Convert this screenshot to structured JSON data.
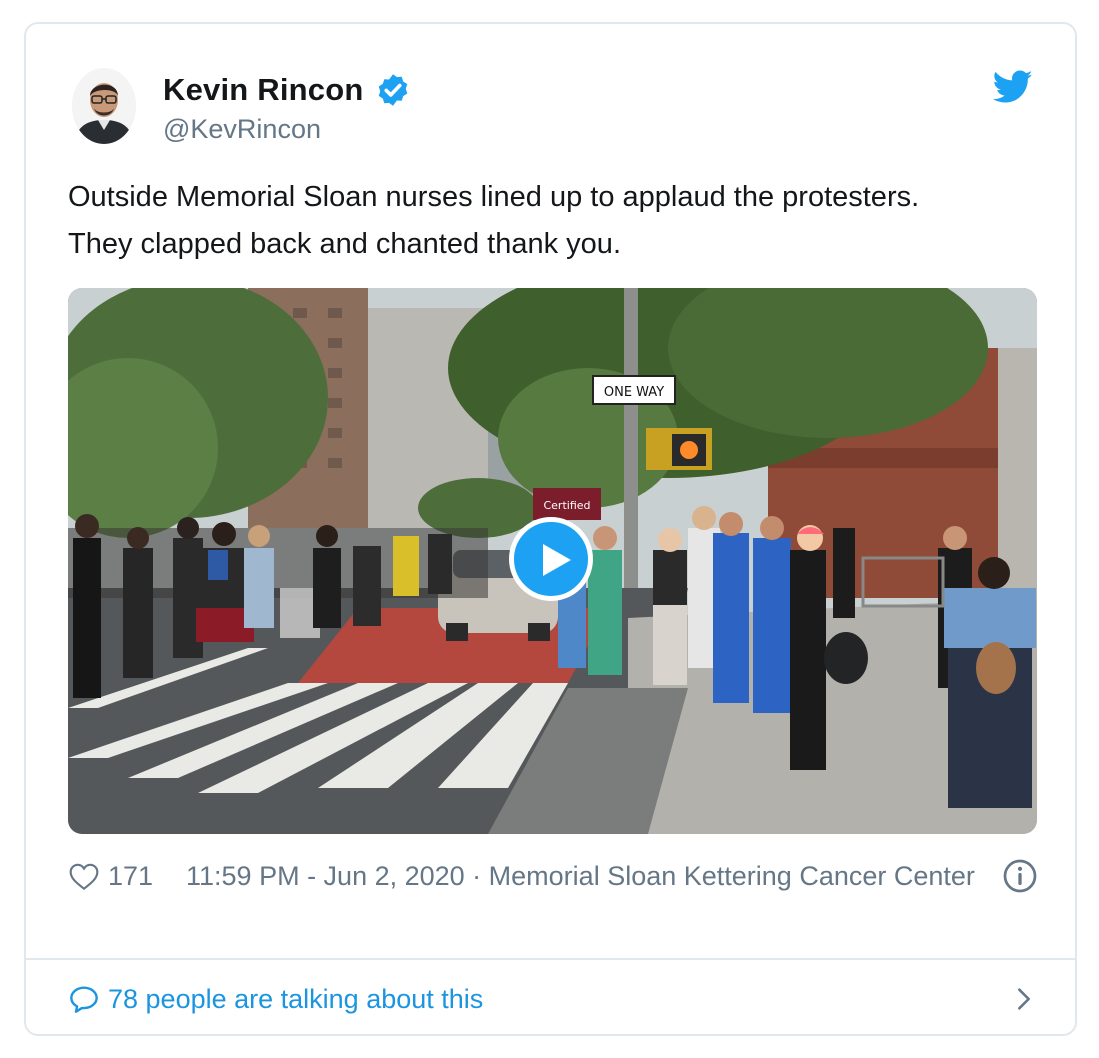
{
  "user": {
    "name": "Kevin Rincon",
    "handle": "@KevRincon",
    "verified": true,
    "avatar_icon": "profile-photo"
  },
  "brand": {
    "icon": "twitter-bird-icon",
    "accent": "#1da1f2"
  },
  "tweet": {
    "text": "Outside Memorial Sloan nurses lined up to applaud the protesters. They clapped back and chanted thank you."
  },
  "media": {
    "type": "video",
    "play_icon": "play-icon",
    "signs": {
      "one_way": "ONE WAY",
      "certified": "Certified"
    }
  },
  "meta": {
    "like_count": "171",
    "timestamp_location": "11:59 PM - Jun 2, 2020 · Memorial Sloan Kettering Cancer Center"
  },
  "footer": {
    "talking": "78 people are talking about this"
  },
  "colors": {
    "text_primary": "#14171a",
    "text_secondary": "#657786",
    "link": "#1b95e0",
    "border": "#e1e8ed"
  }
}
